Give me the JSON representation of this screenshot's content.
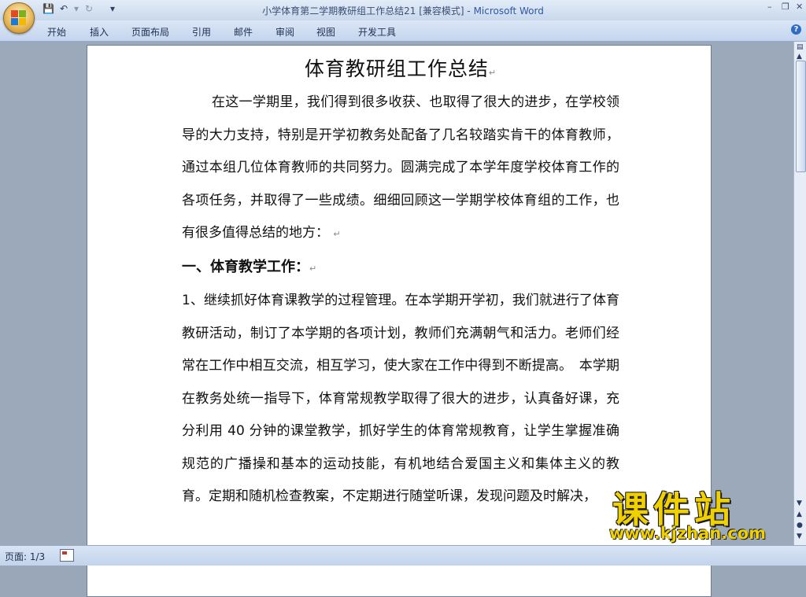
{
  "window": {
    "title": "小学体育第二学期教研组工作总结21 [兼容模式]",
    "title_separator": " - ",
    "app_name": "Microsoft Word"
  },
  "quick_access": {
    "save_icon": "save-icon",
    "undo_icon": "undo-icon",
    "redo_icon": "redo-icon",
    "customize_icon": "dropdown-icon"
  },
  "ribbon": {
    "tabs": [
      "开始",
      "插入",
      "页面布局",
      "引用",
      "邮件",
      "审阅",
      "视图",
      "开发工具"
    ],
    "help": "?"
  },
  "document": {
    "title": "体育教研组工作总结",
    "paragraphs": [
      "在这一学期里，我们得到很多收获、也取得了很大的进步，在学校领导的大力支持，特别是开学初教务处配备了几名较踏实肯干的体育教师，通过本组几位体育教师的共同努力。圆满完成了本学年度学校体育工作的各项任务，并取得了一些成绩。细细回顾这一学期学校体育组的工作，也有很多值得总结的地方："
    ],
    "heading1": "一、体育教学工作：",
    "paragraph2": "1、继续抓好体育课教学的过程管理。在本学期开学初，我们就进行了体育教研活动，制订了本学期的各项计划，教师们充满朝气和活力。老师们经常在工作中相互交流，相互学习，使大家在工作中得到不断提高。　本学期在教务处统一指导下，体育常规教学取得了很大的进步，认真备好课，充分利用 40 分钟的课堂教学，抓好学生的体育常规教育，让学生掌握准确规范的广播操和基本的运动技能，有机地结合爱国主义和集体主义的教育。定期和随机检查教案，不定期进行随堂听课，发现问题及时解决，"
  },
  "statusbar": {
    "page": "页面: 1/3"
  },
  "watermark": {
    "cn": "课件站",
    "en": "www.kjzhan.com"
  },
  "colors": {
    "title_app": "#2d58a8",
    "watermark": "#f0d000"
  }
}
